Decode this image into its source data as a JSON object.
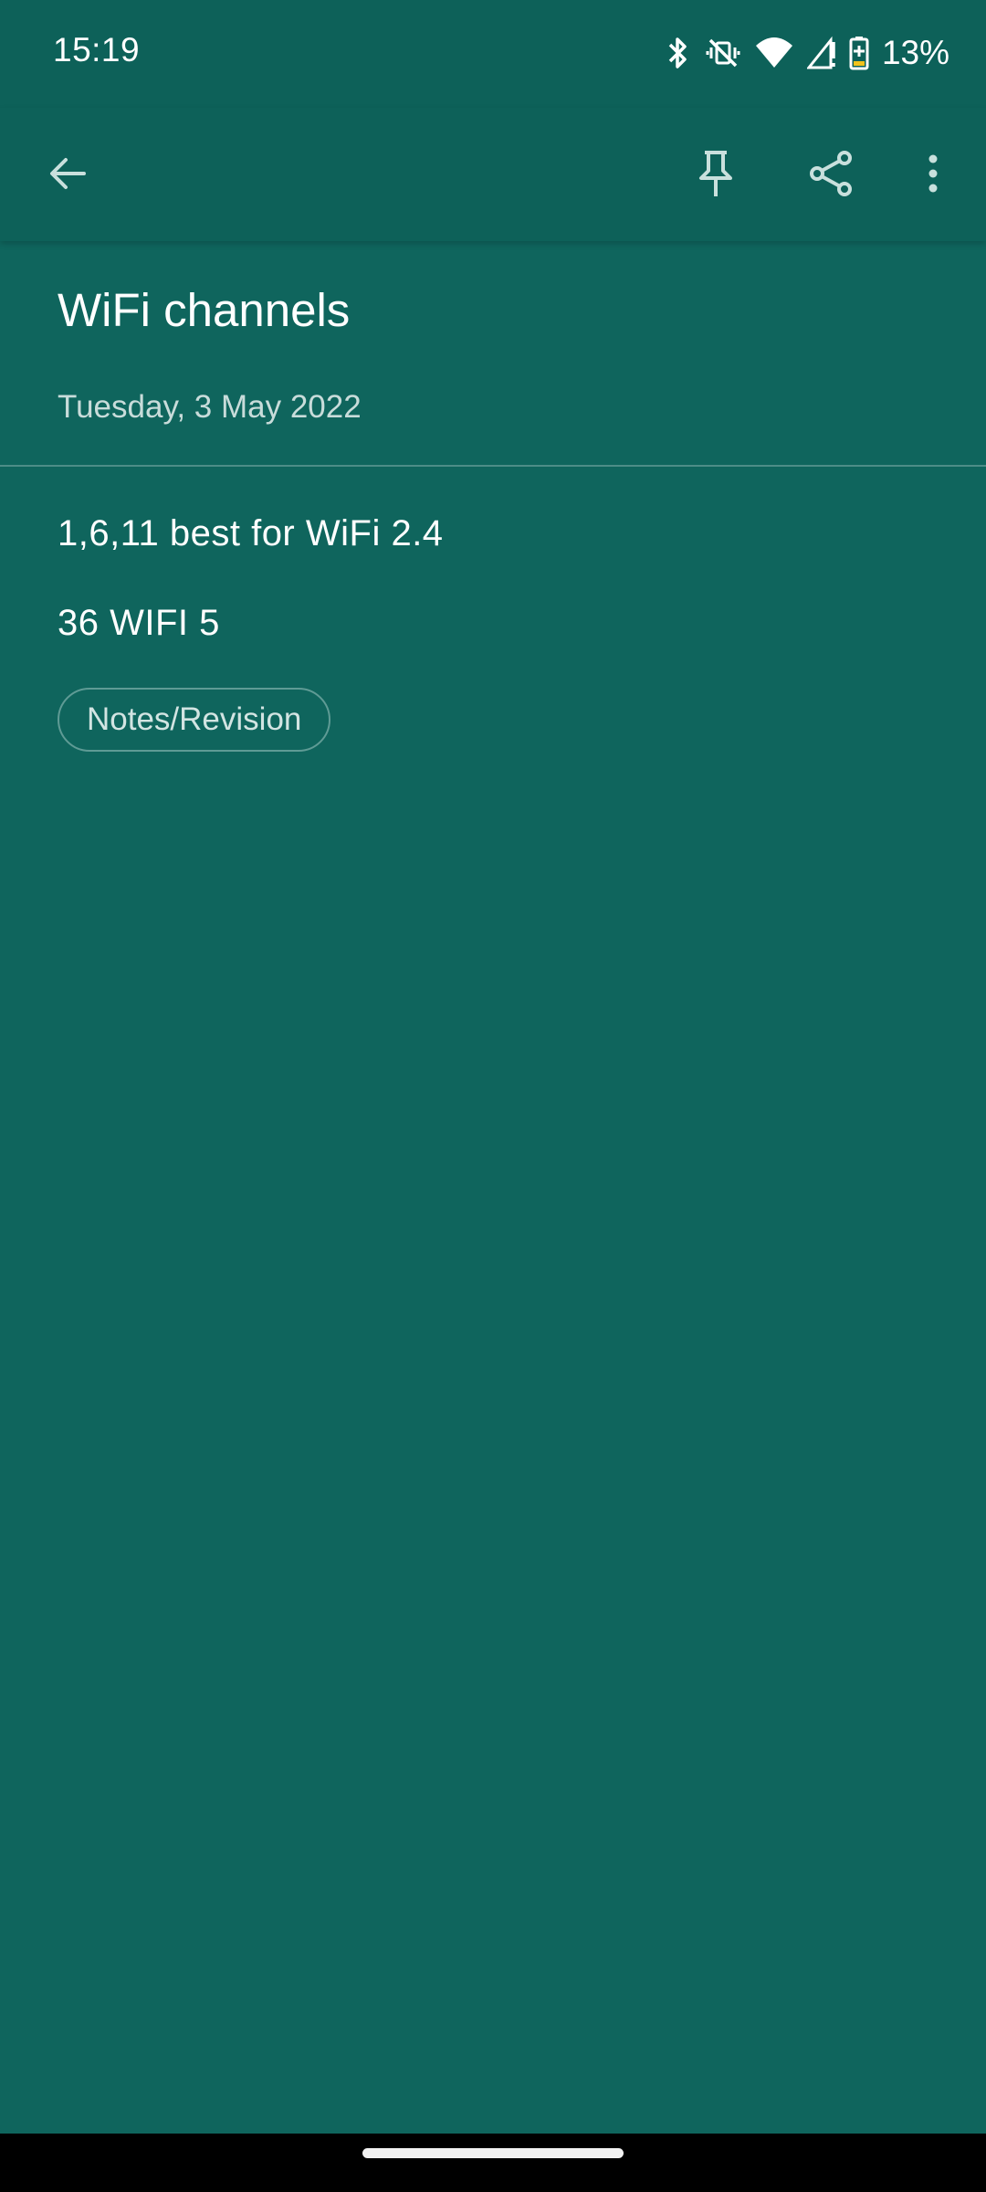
{
  "status_bar": {
    "time": "15:19",
    "battery_percent": "13%",
    "icons": [
      "bluetooth-icon",
      "vibrate-off-icon",
      "wifi-icon",
      "signal-icon",
      "battery-charging-icon"
    ]
  },
  "app_bar": {
    "back_icon": "arrow-back-icon",
    "pin_icon": "pin-icon",
    "share_icon": "share-icon",
    "more_icon": "more-vertical-icon"
  },
  "note": {
    "title": "WiFi channels",
    "date": "Tuesday, 3 May 2022",
    "lines": [
      "1,6,11 best for WiFi 2.4",
      "36 WIFI 5"
    ],
    "tag": "Notes/Revision"
  },
  "colors": {
    "background": "#0f655d",
    "app_bar": "#0d6159",
    "text": "#ffffff",
    "secondary_text": "#c8dcda"
  }
}
